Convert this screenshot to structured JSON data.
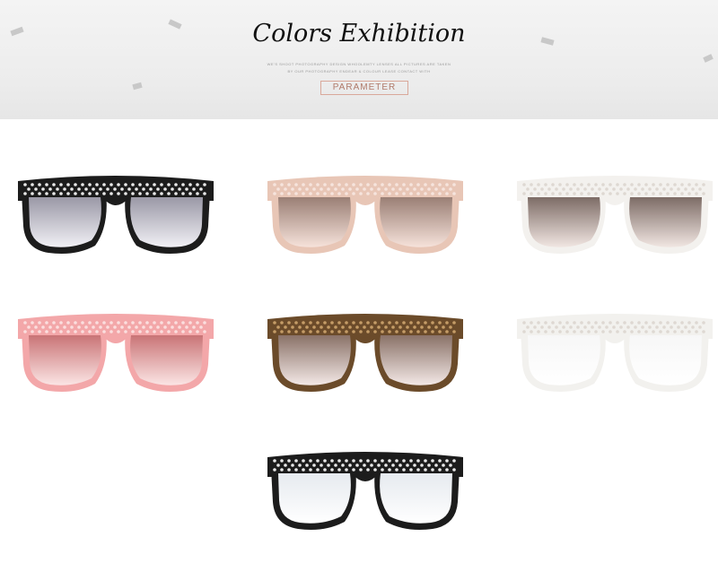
{
  "banner": {
    "title": "Colors Exhibition",
    "small_line_1": "WE'S SHOOT PHOTOGRAPHY DESIGN WHOOLEMTY LENSES ALL PICTURES ARE TAKEN",
    "small_line_2": "BY OUR PHOTOGRAPHY ENDEAR & COLOUR LEASE CONTACT WITH",
    "button_label": "PARAMETER"
  },
  "products": [
    {
      "id": "black-gray",
      "frame": "#1c1c1c",
      "lens_top": "#9a98a6",
      "lens_bottom": "#f1f0f5",
      "studs": "#f3f3f3"
    },
    {
      "id": "champagne",
      "frame": "#e8c6b6",
      "lens_top": "#9a7f75",
      "lens_bottom": "#f6e2da",
      "studs": "#f7e6df"
    },
    {
      "id": "white-brown",
      "frame": "#f3f1ee",
      "lens_top": "#7d6c66",
      "lens_bottom": "#f1e6e2",
      "studs": "#dcd6d0"
    },
    {
      "id": "pink",
      "frame": "#f3a7a9",
      "lens_top": "#c97476",
      "lens_bottom": "#fbe4e4",
      "studs": "#fbe0e0"
    },
    {
      "id": "leopard",
      "frame": "#6b4b2a",
      "lens_top": "#8a7268",
      "lens_bottom": "#f3e8e6",
      "studs": "#c9a06a"
    },
    {
      "id": "white-clear",
      "frame": "#f2f1ee",
      "lens_top": "#f7f7f7",
      "lens_bottom": "#ffffff",
      "studs": "#dcd6d0"
    },
    {
      "id": "black-clear",
      "frame": "#1c1c1c",
      "lens_top": "#e6eaef",
      "lens_bottom": "#ffffff",
      "studs": "#f3f3f3"
    }
  ]
}
